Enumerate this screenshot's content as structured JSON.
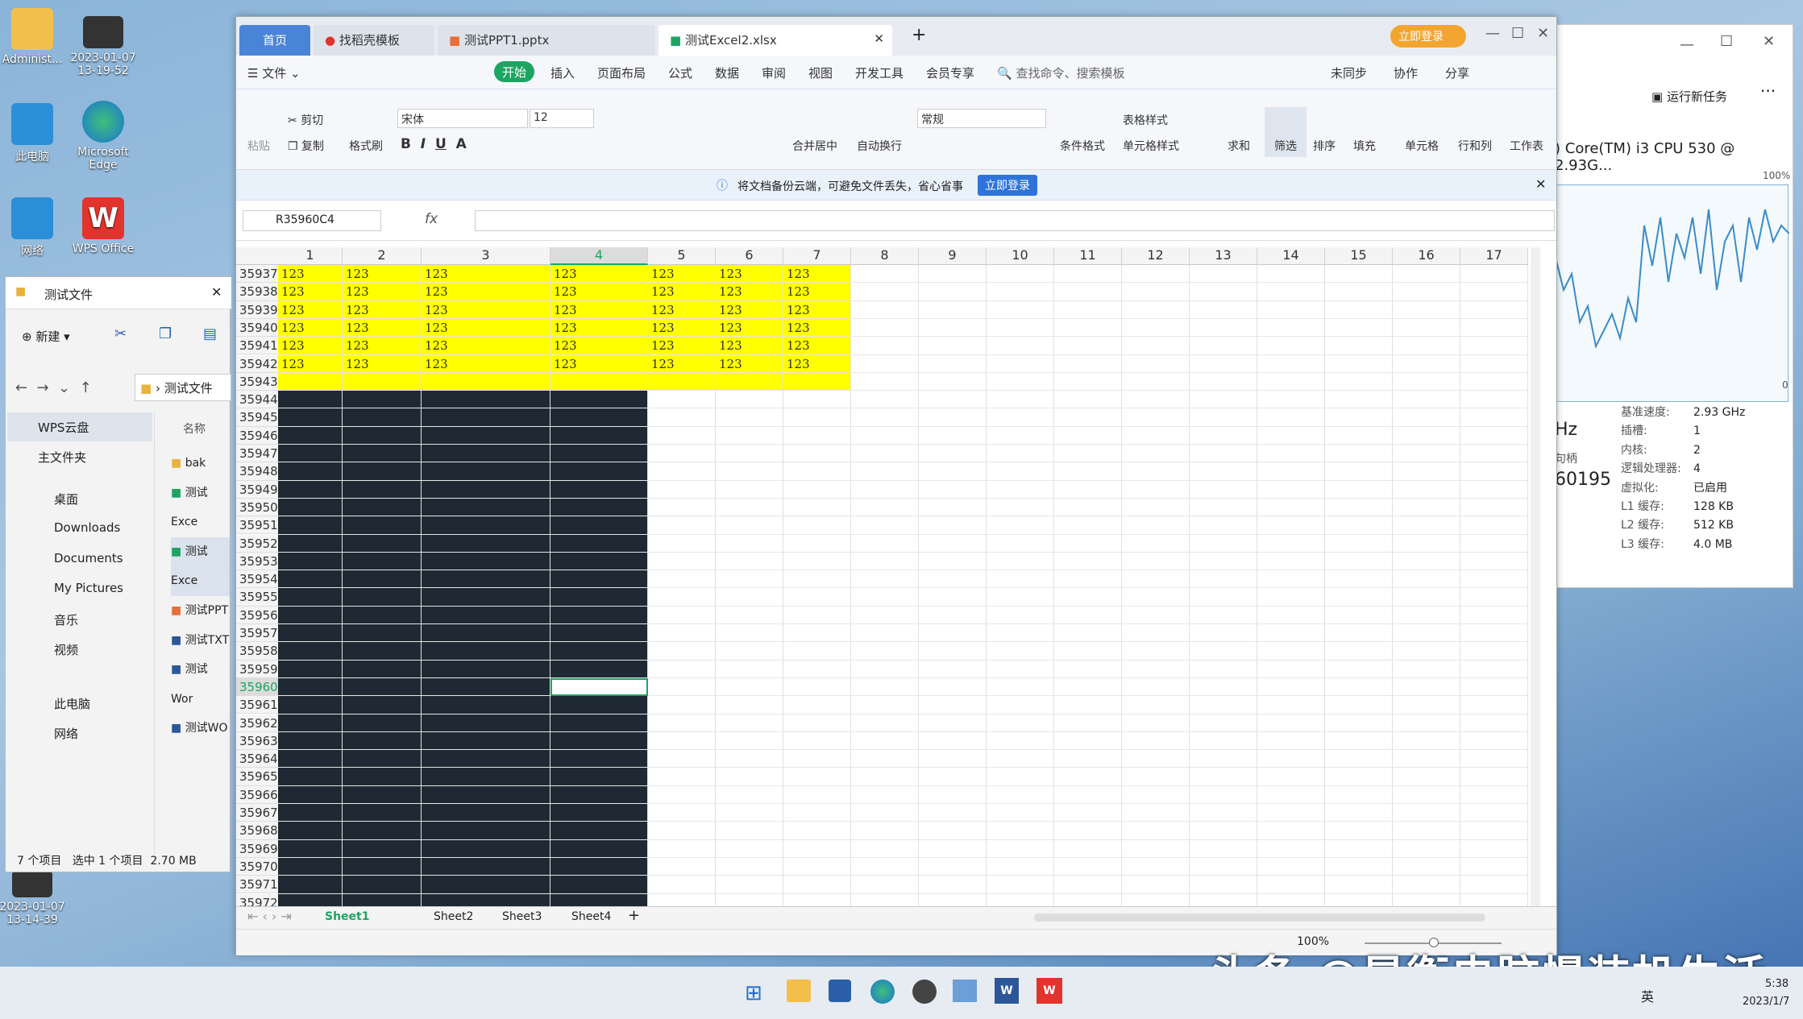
{
  "desktop": {
    "icons": [
      {
        "label": "Administ..."
      },
      {
        "label": "2023-01-07\n13-19-52"
      },
      {
        "label": "此电脑"
      },
      {
        "label": "Microsoft\nEdge"
      },
      {
        "label": "网络"
      },
      {
        "label": "WPS Office"
      },
      {
        "label": "2023-01-07\n13-14-39"
      }
    ]
  },
  "taskmgr": {
    "cpu_name": ") Core(TM) i3 CPU 530 @ 2.93G...",
    "run_task": "运行新任务",
    "pct_top": "100%",
    "pct_bottom": "0",
    "big_label": "Hz",
    "handles_label": "句柄",
    "handles_value": "60195",
    "specs": [
      {
        "k": "基准速度:",
        "v": "2.93 GHz"
      },
      {
        "k": "插槽:",
        "v": "1"
      },
      {
        "k": "内核:",
        "v": "2"
      },
      {
        "k": "逻辑处理器:",
        "v": "4"
      },
      {
        "k": "虚拟化:",
        "v": "已启用"
      },
      {
        "k": "L1 缓存:",
        "v": "128 KB"
      },
      {
        "k": "L2 缓存:",
        "v": "512 KB"
      },
      {
        "k": "L3 缓存:",
        "v": "4.0 MB"
      }
    ]
  },
  "explorer": {
    "title": "测试文件",
    "new_label": "新建",
    "path": "测试文件",
    "col_name": "名称",
    "nav": [
      {
        "label": "WPS云盘"
      },
      {
        "label": "主文件夹"
      },
      {
        "label": "桌面"
      },
      {
        "label": "Downloads"
      },
      {
        "label": "Documents"
      },
      {
        "label": "My Pictures"
      },
      {
        "label": "音乐"
      },
      {
        "label": "视频"
      },
      {
        "label": "此电脑"
      },
      {
        "label": "网络"
      }
    ],
    "files": [
      {
        "label": "bak"
      },
      {
        "label": "测试Exce"
      },
      {
        "label": "测试Exce"
      },
      {
        "label": "测试PPT"
      },
      {
        "label": "测试TXT"
      },
      {
        "label": "测试Wor"
      },
      {
        "label": "测试WO"
      }
    ],
    "status": {
      "count": "7 个项目",
      "selected": "选中 1 个项目",
      "size": "2.70 MB"
    }
  },
  "excel": {
    "tabs": [
      {
        "label": "首页"
      },
      {
        "label": "找稻壳模板"
      },
      {
        "label": "测试PPT1.pptx"
      },
      {
        "label": "测试Excel2.xlsx"
      }
    ],
    "login": "立即登录",
    "menus": [
      "文件",
      "开始",
      "插入",
      "页面布局",
      "公式",
      "数据",
      "审阅",
      "视图",
      "开发工具",
      "会员专享"
    ],
    "search": "查找命令、搜索模板",
    "right_menus": [
      "未同步",
      "协作",
      "分享"
    ],
    "ribbon": {
      "paste": "粘贴",
      "cut": "剪切",
      "copy": "复制",
      "format_painter": "格式刷",
      "font": "宋体",
      "size": "12",
      "merge": "合并居中",
      "wrap": "自动换行",
      "numfmt": "常规",
      "cond": "条件格式",
      "tablestyle": "表格样式",
      "cellstyle": "单元格样式",
      "sum": "求和",
      "filter": "筛选",
      "sort": "排序",
      "fill": "填充",
      "cell": "单元格",
      "rowcol": "行和列",
      "sheet": "工作表"
    },
    "notice": "将文档备份云端，可避免文件丢失，省心省事",
    "notice_btn": "立即登录",
    "namebox": "R35960C4",
    "fx": "fx",
    "cols": [
      "1",
      "2",
      "3",
      "4",
      "5",
      "6",
      "7",
      "8",
      "9",
      "10",
      "11",
      "12",
      "13",
      "14",
      "15",
      "16",
      "17"
    ],
    "first_row": 35937,
    "row_count": 37,
    "cell_value": "123",
    "sheets": [
      "Sheet1",
      "Sheet2",
      "Sheet3",
      "Sheet4"
    ],
    "zoom": "100%"
  },
  "watermark": "头条 @昊衡电脑慢装机生活",
  "tray": {
    "lang": "英",
    "time": "5:38",
    "date": "2023/1/7"
  }
}
